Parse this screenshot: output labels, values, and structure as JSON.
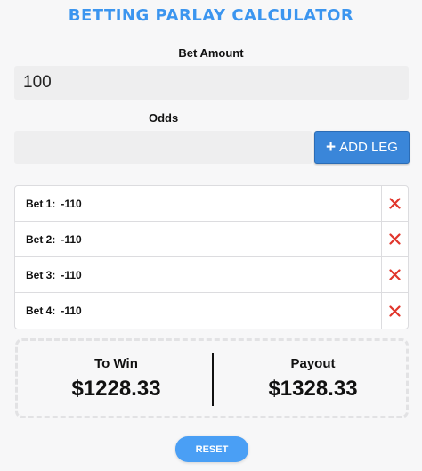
{
  "app": {
    "title": "BETTING PARLAY CALCULATOR"
  },
  "bet_amount": {
    "label": "Bet Amount",
    "value": "100"
  },
  "odds": {
    "label": "Odds",
    "value": "",
    "placeholder": ""
  },
  "add_leg": {
    "icon": "plus-icon",
    "label": "ADD LEG"
  },
  "legs": [
    {
      "label": "Bet 1:",
      "odds": "-110",
      "delete_icon": "close-icon"
    },
    {
      "label": "Bet 2:",
      "odds": "-110",
      "delete_icon": "close-icon"
    },
    {
      "label": "Bet 3:",
      "odds": "-110",
      "delete_icon": "close-icon"
    },
    {
      "label": "Bet 4:",
      "odds": "-110",
      "delete_icon": "close-icon"
    }
  ],
  "summary": {
    "to_win": {
      "label": "To Win",
      "value": "$1228.33"
    },
    "payout": {
      "label": "Payout",
      "value": "$1328.33"
    }
  },
  "reset": {
    "label": "RESET"
  },
  "colors": {
    "title": "#3b95ef",
    "add_button": "#3a86d9",
    "reset_button": "#4a9ff5",
    "delete_icon": "#e0352b"
  }
}
